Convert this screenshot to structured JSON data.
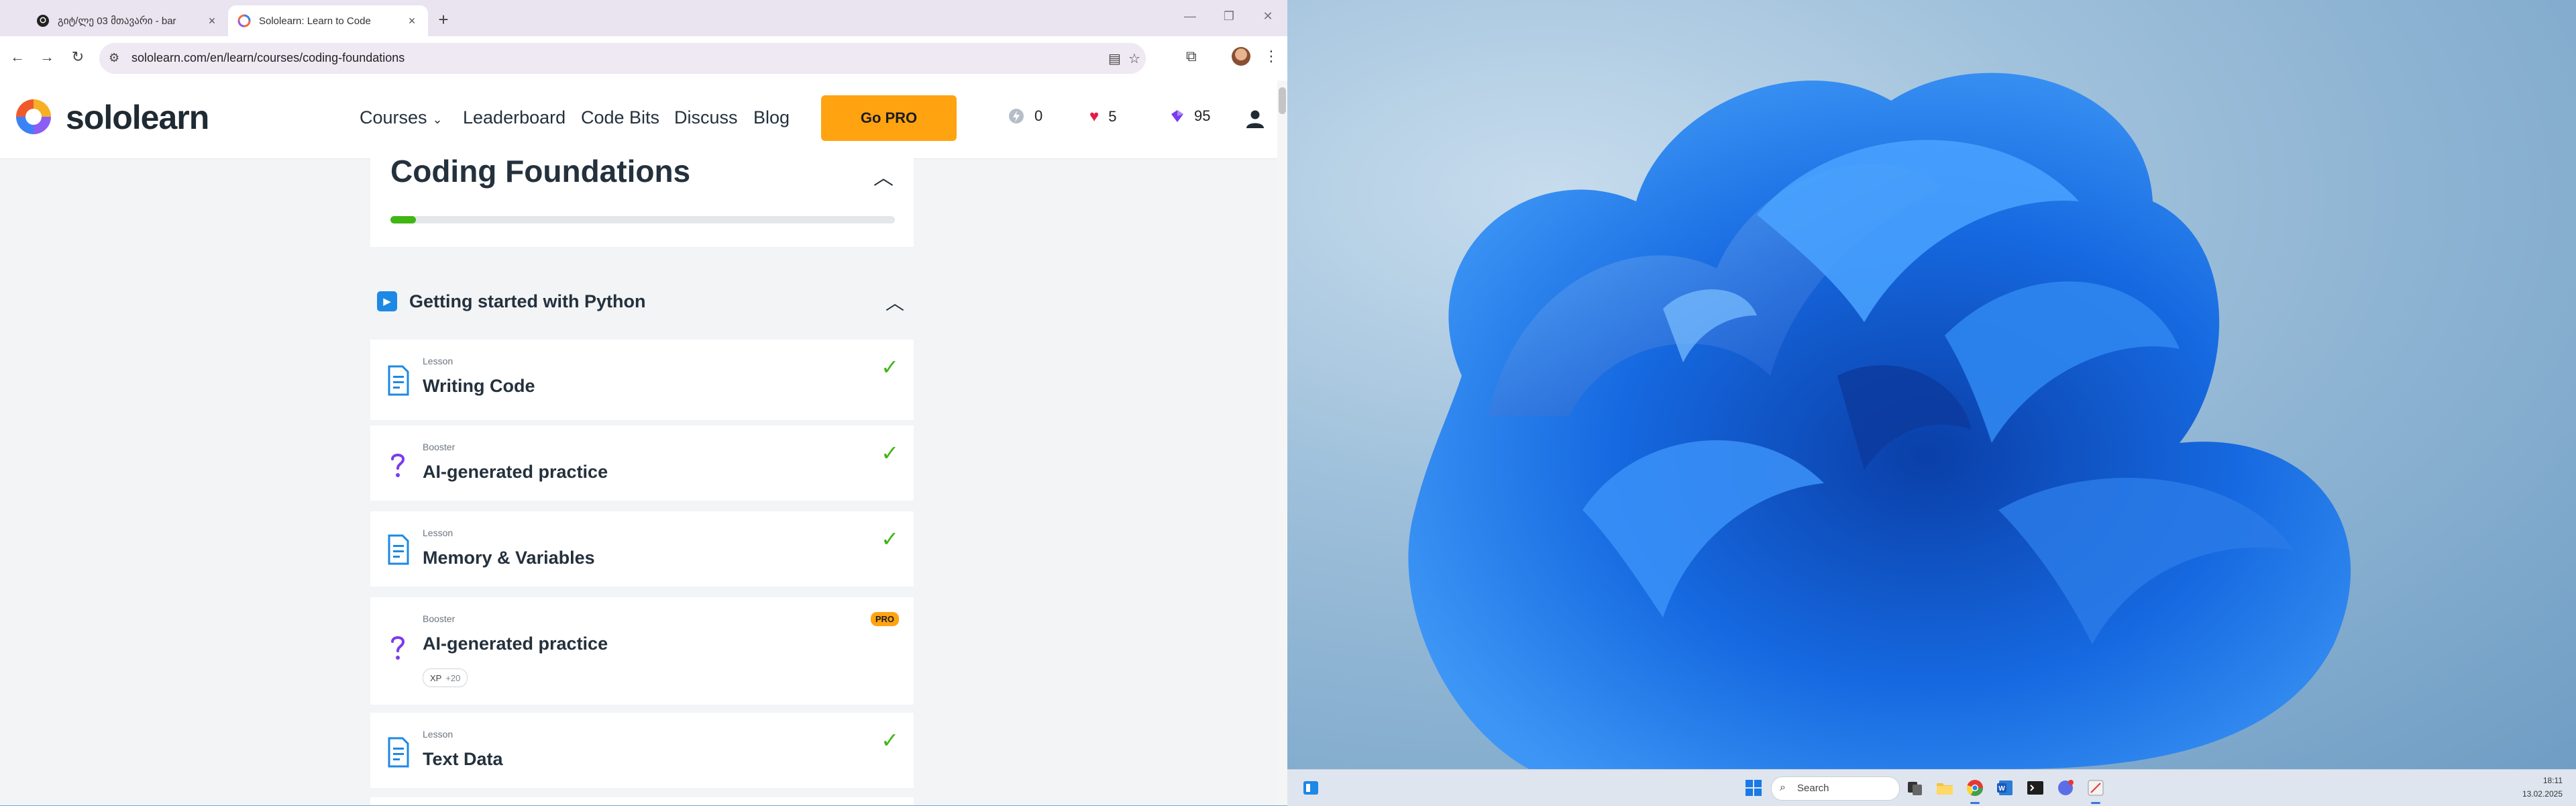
{
  "browser": {
    "tabs": [
      {
        "title": "გიტ/ლე 03 მთავარი - bar",
        "close": "×",
        "active": false,
        "icon": "github-icon"
      },
      {
        "title": "Sololearn: Learn to Code",
        "close": "×",
        "active": true,
        "icon": "sololearn-icon"
      }
    ],
    "new_tab": "+",
    "window_controls": {
      "minimize": "—",
      "restore": "❐",
      "close": "✕"
    },
    "nav": {
      "back": "←",
      "forward": "→",
      "reload": "↻"
    },
    "url": "sololearn.com/en/learn/courses/coding-foundations",
    "icons": [
      "translate-icon",
      "star-icon",
      "extensions-icon",
      "profile-avatar",
      "menu-icon"
    ]
  },
  "header": {
    "brand": "sololearn",
    "nav": {
      "courses": "Courses",
      "leaderboard": "Leaderboard",
      "codebits": "Code Bits",
      "discuss": "Discuss",
      "blog": "Blog"
    },
    "gopro": "Go PRO",
    "stats": {
      "streak": "0",
      "hearts": "5",
      "gems": "95"
    },
    "colors": {
      "accent": "#ffa310",
      "progress": "#3fb614",
      "module": "#1e88e5"
    }
  },
  "course": {
    "title": "Coding Foundations",
    "progress": 0.05
  },
  "module": {
    "title": "Getting started with Python"
  },
  "lessons": [
    {
      "type": "Lesson",
      "title": "Writing Code",
      "completed": true,
      "icon": "document-icon"
    },
    {
      "type": "Booster",
      "title": "AI-generated practice",
      "completed": true,
      "icon": "question-icon"
    },
    {
      "type": "Lesson",
      "title": "Memory & Variables",
      "completed": true,
      "icon": "document-icon"
    },
    {
      "type": "Booster",
      "title": "AI-generated practice",
      "completed": false,
      "pro": "PRO",
      "xp_label": "XP",
      "xp_value": "+20",
      "icon": "question-icon"
    },
    {
      "type": "Lesson",
      "title": "Text Data",
      "completed": true,
      "icon": "document-icon"
    }
  ],
  "taskbar": {
    "search": "Search",
    "time": "18:11",
    "date": "13.02.2025"
  }
}
